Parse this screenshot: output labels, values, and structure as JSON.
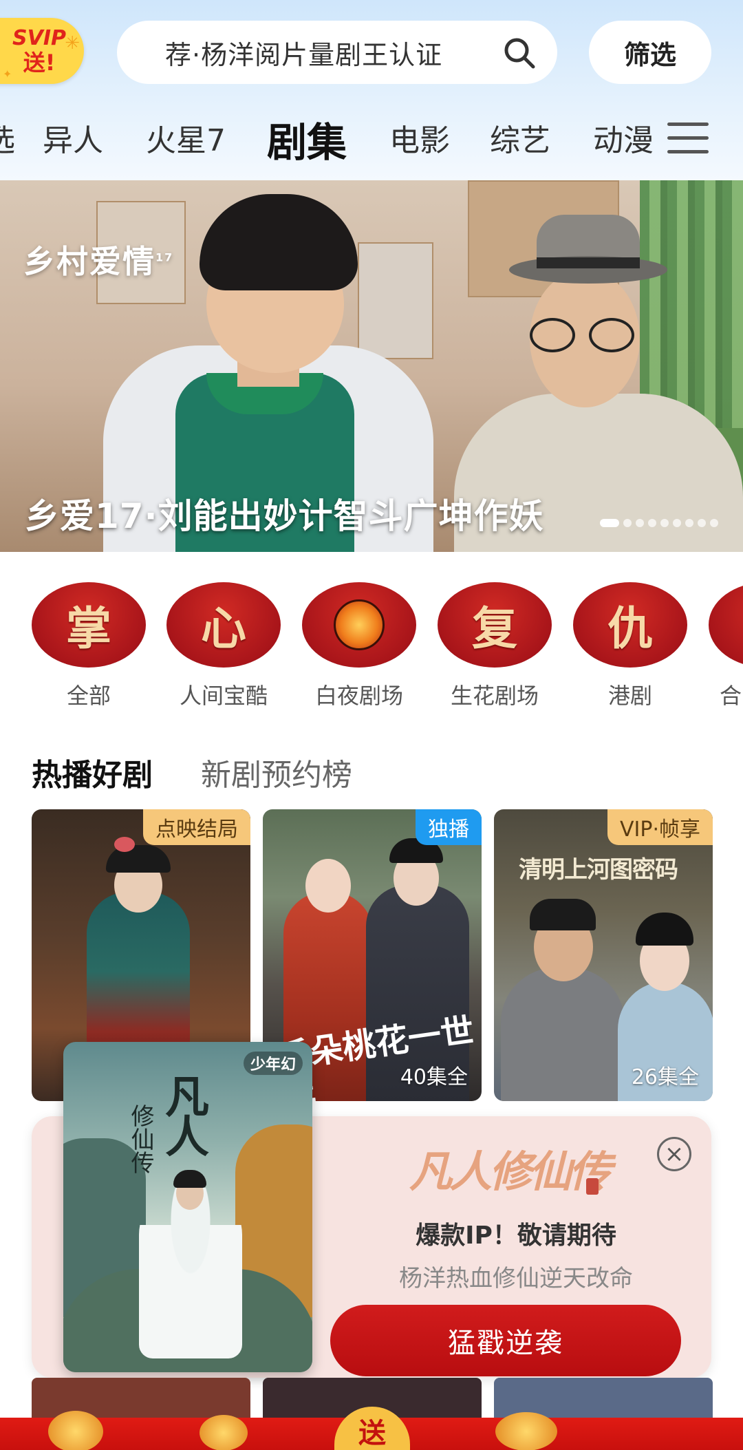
{
  "header": {
    "svip_line1": "SVIP",
    "svip_line2": "送!",
    "search_text": "荐·杨洋阅片量剧王认证",
    "filter_label": "筛选"
  },
  "nav_tabs": [
    {
      "label": "选"
    },
    {
      "label": "异人"
    },
    {
      "label": "火星7"
    },
    {
      "label": "剧集",
      "active": true
    },
    {
      "label": "电影"
    },
    {
      "label": "综艺"
    },
    {
      "label": "动漫"
    }
  ],
  "banner": {
    "logo": "乡村爱情",
    "logo_sup": "17",
    "caption": "乡爱17·刘能出妙计智斗广坤作妖",
    "slide_count": 9,
    "active_slide": 1
  },
  "categories": [
    {
      "glyph": "掌",
      "label": "全部"
    },
    {
      "glyph": "心",
      "label": "人间宝酷"
    },
    {
      "glyph": "",
      "label": "白夜剧场",
      "icon": "flame-emblem-icon"
    },
    {
      "glyph": "复",
      "label": "生花剧场"
    },
    {
      "glyph": "仇",
      "label": "港剧"
    },
    {
      "glyph": "",
      "label": "合"
    }
  ],
  "section_tabs": [
    {
      "label": "热播好剧",
      "active": true
    },
    {
      "label": "新剧预约榜"
    }
  ],
  "posters": [
    {
      "badge": "点映结局",
      "badge_bg": "#f6c77a",
      "badge_color": "#5a3b10",
      "episodes": ""
    },
    {
      "badge": "独播",
      "badge_bg": "#1f9bf0",
      "badge_color": "#ffffff",
      "title_art": "千朵桃花一世开",
      "episodes": "40集全"
    },
    {
      "badge": "VIP·帧享",
      "badge_bg": "#f6c77a",
      "badge_color": "#5a3b10",
      "title_art": "清明上河图密码",
      "episodes": "26集全"
    }
  ],
  "popup": {
    "poster_brand": "少年幻",
    "poster_calligraphy": "凡人",
    "poster_calligraphy_2": "修仙传",
    "logo_text": "凡人修仙传",
    "title": "爆款IP！敬请期待",
    "subtitle": "杨洋热血修仙逆天改命",
    "button_label": "猛戳逆袭",
    "close_symbol": "×"
  },
  "bottom": {
    "send_label": "送"
  },
  "colors": {
    "accent_red": "#c8100d",
    "category_red": "#a9151a",
    "vip_gold": "#f6c77a",
    "exclusive_blue": "#1f9bf0"
  }
}
